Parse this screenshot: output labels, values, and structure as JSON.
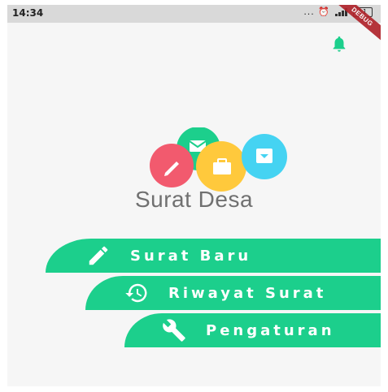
{
  "status_bar": {
    "time": "14:34",
    "icons_text": "... ⏰",
    "battery": "41"
  },
  "debug_banner": "DEBUG",
  "app": {
    "title": "Surat Desa"
  },
  "menu": {
    "items": [
      {
        "label": "Surat Baru",
        "icon": "pencil-icon"
      },
      {
        "label": "Riwayat Surat",
        "icon": "history-icon"
      },
      {
        "label": "Pengaturan",
        "icon": "wrench-icon"
      }
    ]
  },
  "colors": {
    "accent": "#1ccf8c",
    "logo_green": "#1ccf8c",
    "logo_red": "#f25a6e",
    "logo_yellow": "#ffc93c",
    "logo_cyan": "#45d3f2",
    "title_gray": "#707070"
  },
  "icons": [
    "notification-bell-icon",
    "envelope-icon",
    "pencil-icon",
    "briefcase-icon",
    "safe-icon",
    "history-icon",
    "wrench-icon"
  ]
}
